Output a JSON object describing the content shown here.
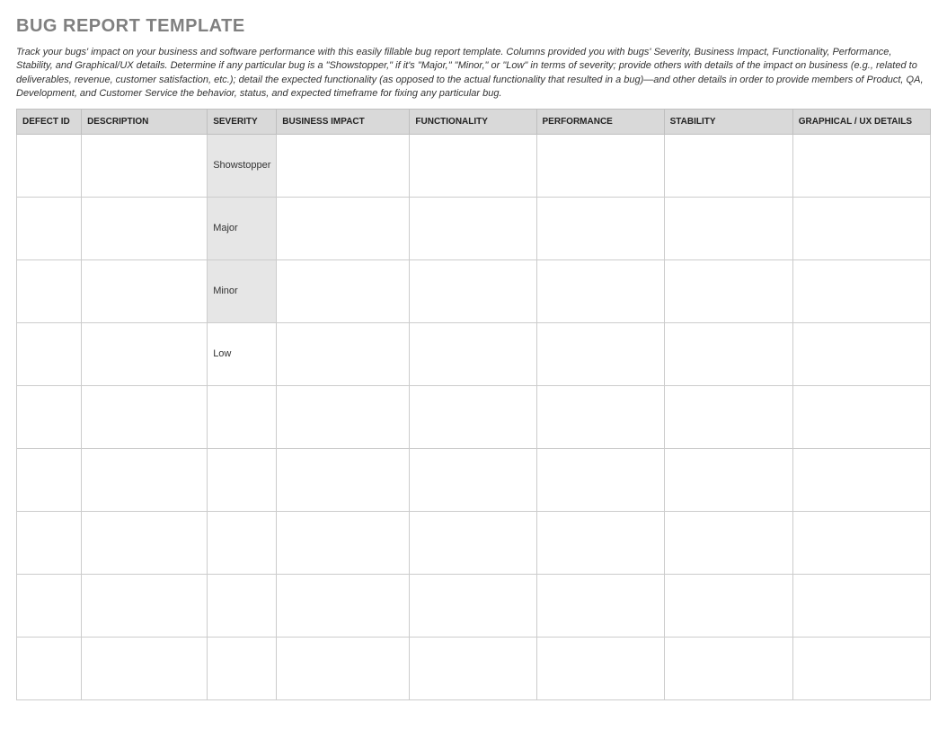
{
  "title": "BUG REPORT TEMPLATE",
  "description": "Track your bugs' impact on your business and software performance with this easily fillable bug report template. Columns provided you with bugs' Severity, Business Impact, Functionality, Performance, Stability, and Graphical/UX details. Determine if any particular bug is a \"Showstopper,\" if it's \"Major,\" \"Minor,\" or \"Low\" in terms of severity; provide others with details of the impact on business (e.g., related to deliverables, revenue, customer satisfaction, etc.); detail the expected functionality (as opposed to the actual functionality that resulted in a bug)—and other details in order to provide members of Product, QA, Development, and Customer Service the behavior, status, and expected timeframe for fixing any particular bug.",
  "columns": {
    "defect_id": "DEFECT ID",
    "description": "DESCRIPTION",
    "severity": "SEVERITY",
    "business_impact": "BUSINESS IMPACT",
    "functionality": "FUNCTIONALITY",
    "performance": "PERFORMANCE",
    "stability": "STABILITY",
    "graphical_ux": "GRAPHICAL / UX DETAILS"
  },
  "rows": [
    {
      "defect_id": "",
      "description": "",
      "severity": "Showstopper",
      "severity_filled": true,
      "business_impact": "",
      "functionality": "",
      "performance": "",
      "stability": "",
      "graphical_ux": ""
    },
    {
      "defect_id": "",
      "description": "",
      "severity": "Major",
      "severity_filled": true,
      "business_impact": "",
      "functionality": "",
      "performance": "",
      "stability": "",
      "graphical_ux": ""
    },
    {
      "defect_id": "",
      "description": "",
      "severity": "Minor",
      "severity_filled": true,
      "business_impact": "",
      "functionality": "",
      "performance": "",
      "stability": "",
      "graphical_ux": ""
    },
    {
      "defect_id": "",
      "description": "",
      "severity": "Low",
      "severity_filled": false,
      "business_impact": "",
      "functionality": "",
      "performance": "",
      "stability": "",
      "graphical_ux": ""
    },
    {
      "defect_id": "",
      "description": "",
      "severity": "",
      "severity_filled": false,
      "business_impact": "",
      "functionality": "",
      "performance": "",
      "stability": "",
      "graphical_ux": ""
    },
    {
      "defect_id": "",
      "description": "",
      "severity": "",
      "severity_filled": false,
      "business_impact": "",
      "functionality": "",
      "performance": "",
      "stability": "",
      "graphical_ux": ""
    },
    {
      "defect_id": "",
      "description": "",
      "severity": "",
      "severity_filled": false,
      "business_impact": "",
      "functionality": "",
      "performance": "",
      "stability": "",
      "graphical_ux": ""
    },
    {
      "defect_id": "",
      "description": "",
      "severity": "",
      "severity_filled": false,
      "business_impact": "",
      "functionality": "",
      "performance": "",
      "stability": "",
      "graphical_ux": ""
    },
    {
      "defect_id": "",
      "description": "",
      "severity": "",
      "severity_filled": false,
      "business_impact": "",
      "functionality": "",
      "performance": "",
      "stability": "",
      "graphical_ux": ""
    }
  ]
}
